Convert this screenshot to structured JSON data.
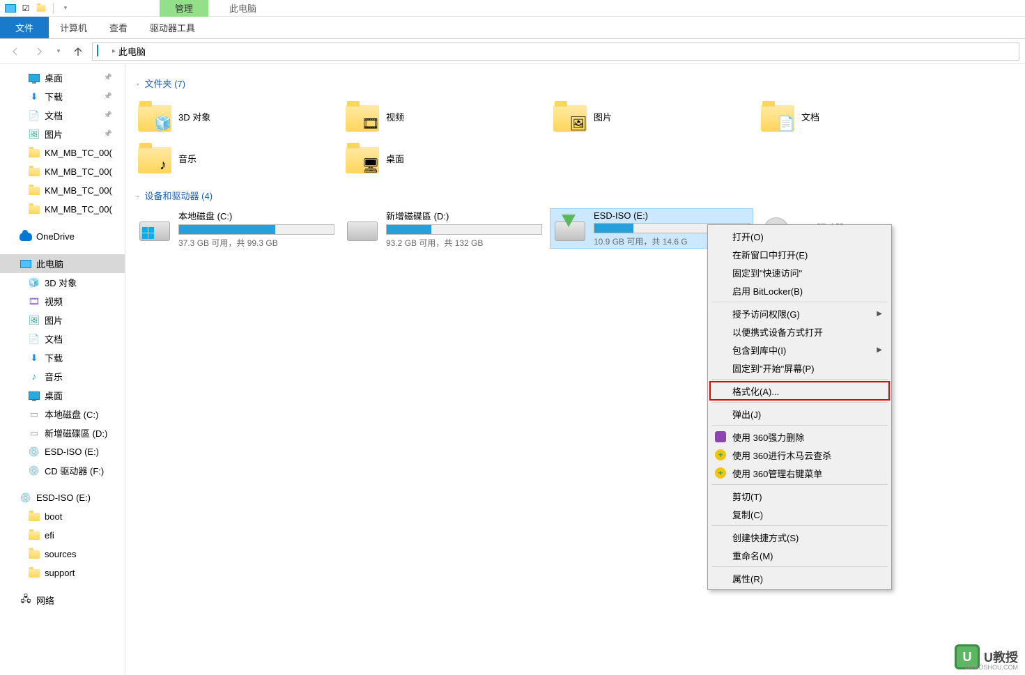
{
  "titlebar": {
    "context_tab": "管理",
    "window_title": "此电脑"
  },
  "ribbon": {
    "file": "文件",
    "computer": "计算机",
    "view": "查看",
    "drive_tools": "驱动器工具"
  },
  "breadcrumb": {
    "location": "此电脑"
  },
  "sidebar": {
    "quick": [
      {
        "label": "桌面",
        "icon": "monitor",
        "pinned": true
      },
      {
        "label": "下载",
        "icon": "download",
        "pinned": true
      },
      {
        "label": "文档",
        "icon": "doc",
        "pinned": true
      },
      {
        "label": "图片",
        "icon": "pic",
        "pinned": true
      },
      {
        "label": "KM_MB_TC_00(",
        "icon": "folder"
      },
      {
        "label": "KM_MB_TC_00(",
        "icon": "folder"
      },
      {
        "label": "KM_MB_TC_00(",
        "icon": "folder"
      },
      {
        "label": "KM_MB_TC_00(",
        "icon": "folder"
      }
    ],
    "onedrive": "OneDrive",
    "this_pc": "此电脑",
    "pc_children": [
      {
        "label": "3D 对象",
        "icon": "3d"
      },
      {
        "label": "视频",
        "icon": "video"
      },
      {
        "label": "图片",
        "icon": "pic"
      },
      {
        "label": "文档",
        "icon": "doc"
      },
      {
        "label": "下载",
        "icon": "download"
      },
      {
        "label": "音乐",
        "icon": "music"
      },
      {
        "label": "桌面",
        "icon": "monitor"
      },
      {
        "label": "本地磁盘 (C:)",
        "icon": "drive"
      },
      {
        "label": "新增磁碟區 (D:)",
        "icon": "drive"
      },
      {
        "label": "ESD-ISO (E:)",
        "icon": "iso"
      },
      {
        "label": "CD 驱动器 (F:)",
        "icon": "cd"
      }
    ],
    "esd": "ESD-ISO (E:)",
    "esd_children": [
      "boot",
      "efi",
      "sources",
      "support"
    ],
    "network": "网络"
  },
  "content": {
    "group_folders": "文件夹 (7)",
    "group_drives": "设备和驱动器 (4)",
    "folders": [
      {
        "name": "3D 对象",
        "sub": "cube"
      },
      {
        "name": "视频",
        "sub": "film"
      },
      {
        "name": "图片",
        "sub": "photo"
      },
      {
        "name": "文档",
        "sub": "doc"
      },
      {
        "name": "音乐",
        "sub": "note"
      },
      {
        "name": "桌面",
        "sub": "desk"
      }
    ],
    "drives": [
      {
        "name": "本地磁盘 (C:)",
        "info": "37.3 GB 可用，共 99.3 GB",
        "fill": 62,
        "icon": "win"
      },
      {
        "name": "新增磁碟區 (D:)",
        "info": "93.2 GB 可用，共 132 GB",
        "fill": 29,
        "icon": "hdd"
      },
      {
        "name": "ESD-ISO (E:)",
        "info": "10.9 GB 可用，共 14.6 G",
        "fill": 25,
        "icon": "iso",
        "selected": true
      },
      {
        "name": "CD 驱动器 (F:)",
        "info": "",
        "fill": 0,
        "icon": "cd",
        "nobar": true
      }
    ]
  },
  "context_menu": [
    {
      "label": "打开(O)"
    },
    {
      "label": "在新窗口中打开(E)"
    },
    {
      "label": "固定到\"快速访问\""
    },
    {
      "label": "启用 BitLocker(B)"
    },
    {
      "sep": true
    },
    {
      "label": "授予访问权限(G)",
      "arrow": true
    },
    {
      "label": "以便携式设备方式打开"
    },
    {
      "label": "包含到库中(I)",
      "arrow": true
    },
    {
      "label": "固定到\"开始\"屏幕(P)"
    },
    {
      "sep": true
    },
    {
      "label": "格式化(A)...",
      "highlighted": true
    },
    {
      "sep": true
    },
    {
      "label": "弹出(J)"
    },
    {
      "sep": true
    },
    {
      "label": "使用 360强力删除",
      "icon": "360r"
    },
    {
      "label": "使用 360进行木马云查杀",
      "icon": "360g"
    },
    {
      "label": "使用 360管理右键菜单",
      "icon": "360g"
    },
    {
      "sep": true
    },
    {
      "label": "剪切(T)"
    },
    {
      "label": "复制(C)"
    },
    {
      "sep": true
    },
    {
      "label": "创建快捷方式(S)"
    },
    {
      "label": "重命名(M)"
    },
    {
      "sep": true
    },
    {
      "label": "属性(R)"
    }
  ],
  "watermark": {
    "brand": "U教授",
    "url": "UJIAOSHOU.COM"
  }
}
